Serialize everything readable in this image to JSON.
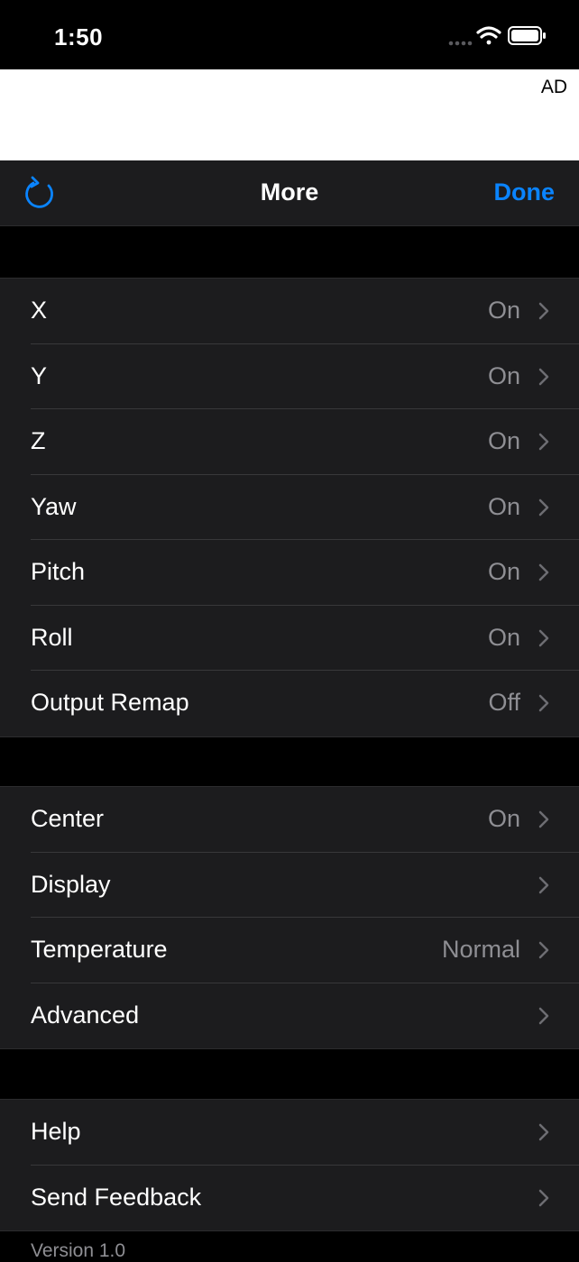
{
  "status": {
    "time": "1:50"
  },
  "ad": {
    "label": "AD"
  },
  "nav": {
    "title": "More",
    "done_label": "Done"
  },
  "groups": [
    {
      "rows": [
        {
          "label": "X",
          "value": "On"
        },
        {
          "label": "Y",
          "value": "On"
        },
        {
          "label": "Z",
          "value": "On"
        },
        {
          "label": "Yaw",
          "value": "On"
        },
        {
          "label": "Pitch",
          "value": "On"
        },
        {
          "label": "Roll",
          "value": "On"
        },
        {
          "label": "Output Remap",
          "value": "Off"
        }
      ]
    },
    {
      "rows": [
        {
          "label": "Center",
          "value": "On"
        },
        {
          "label": "Display",
          "value": ""
        },
        {
          "label": "Temperature",
          "value": "Normal"
        },
        {
          "label": "Advanced",
          "value": ""
        }
      ]
    },
    {
      "rows": [
        {
          "label": "Help",
          "value": ""
        },
        {
          "label": "Send Feedback",
          "value": ""
        }
      ]
    }
  ],
  "footer": {
    "version": "Version 1.0"
  },
  "colors": {
    "accent": "#0a84ff",
    "background": "#000000",
    "cell": "#1c1c1e",
    "secondary_text": "#8e8e93"
  }
}
